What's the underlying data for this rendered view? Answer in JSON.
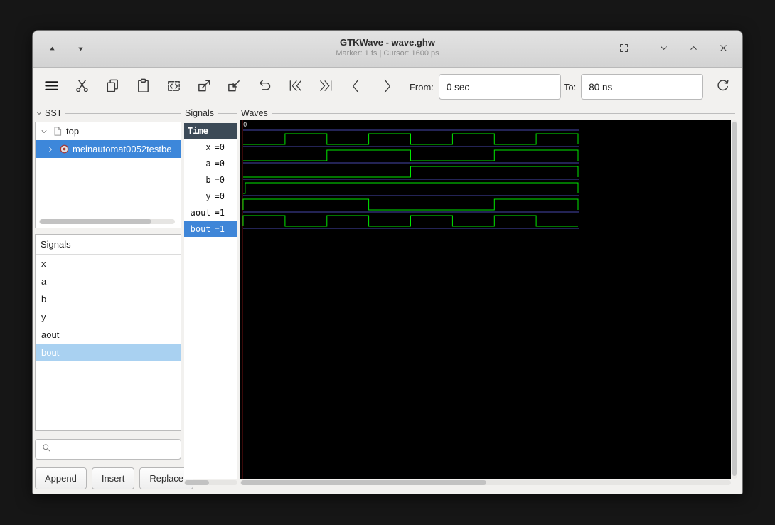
{
  "window": {
    "title": "GTKWave - wave.ghw",
    "status": "Marker: 1 fs | Cursor: 1600 ps"
  },
  "toolbar": {
    "from_label": "From:",
    "from_value": "0 sec",
    "to_label": "To:",
    "to_value": "80 ns"
  },
  "sst_panel": {
    "label": "SST",
    "tree": {
      "root": "top",
      "child": "meinautomat0052testbe"
    }
  },
  "signals_list": {
    "header": "Signals",
    "items": [
      "x",
      "a",
      "b",
      "y",
      "aout",
      "bout"
    ],
    "selected_item": "bout"
  },
  "actions": {
    "append": "Append",
    "insert": "Insert",
    "replace": "Replace"
  },
  "values_panel": {
    "frame_label": "Signals",
    "header": "Time",
    "rows": [
      {
        "name": "x",
        "value": "=0"
      },
      {
        "name": "a",
        "value": "=0"
      },
      {
        "name": "b",
        "value": "=0"
      },
      {
        "name": "y",
        "value": "=0"
      },
      {
        "name": "aout",
        "value": "=1"
      },
      {
        "name": "bout",
        "value": "=1"
      }
    ]
  },
  "waves_panel": {
    "label": "Waves",
    "timeline_zero": "0"
  },
  "colors": {
    "trace_green": "#00e800",
    "separator_blue": "#4646aa",
    "marker_red": "#701010",
    "selection_blue": "#3d87da",
    "list_selection": "#a9d1f1",
    "values_header_bg": "#3c4a57"
  },
  "chart_data": {
    "type": "digital_waveform",
    "time_unit": "ns",
    "t_range": [
      0,
      80
    ],
    "signals": [
      {
        "name": "x",
        "display_value": "=0",
        "initial": 0,
        "toggles_ns": [
          10,
          20,
          30,
          40,
          50,
          60,
          70
        ]
      },
      {
        "name": "a",
        "display_value": "=0",
        "initial": 0,
        "toggles_ns": [
          20,
          40,
          60
        ]
      },
      {
        "name": "b",
        "display_value": "=0",
        "initial": 0,
        "toggles_ns": [
          40
        ]
      },
      {
        "name": "y",
        "display_value": "=0",
        "initial": 0,
        "toggles_ns": [
          0.5
        ]
      },
      {
        "name": "aout",
        "display_value": "=1",
        "initial": 1,
        "toggles_ns": [
          30,
          60
        ]
      },
      {
        "name": "bout",
        "display_value": "=1",
        "initial": 1,
        "toggles_ns": [
          10,
          20,
          30,
          40,
          50,
          60,
          70
        ]
      }
    ]
  }
}
